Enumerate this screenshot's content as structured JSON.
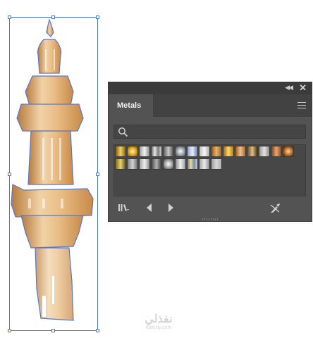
{
  "panel": {
    "tab_label": "Metals",
    "search": {
      "value": "",
      "placeholder": ""
    },
    "swatches": [
      {
        "name": "gold-1",
        "fill": "linear-gradient(90deg,#7a5a10,#f3d36a,#8a6410)"
      },
      {
        "name": "gold-radial",
        "fill": "radial-gradient(circle,#fff2a0,#d9a21a 55%,#6e4a05)"
      },
      {
        "name": "silver-1",
        "fill": "linear-gradient(90deg,#9a9a9a,#f4f4f4,#8a8a8a)"
      },
      {
        "name": "silver-2",
        "fill": "linear-gradient(90deg,#6c6c6c,#e6e6e6,#7a7a7a,#d8d8d8)"
      },
      {
        "name": "steel-1",
        "fill": "linear-gradient(90deg,#5e5e5e,#c9c9c9,#4e4e4e)"
      },
      {
        "name": "chrome-radial",
        "fill": "radial-gradient(circle,#ffffff,#a8b0b8 45%,#3e4348)"
      },
      {
        "name": "blue-steel",
        "fill": "linear-gradient(90deg,#8fa4c8,#e8eef8,#6f86b0)"
      },
      {
        "name": "platinum",
        "fill": "linear-gradient(90deg,#bdbdbd,#f8f8f8,#a9a9a9)"
      },
      {
        "name": "bronze-1",
        "fill": "linear-gradient(90deg,#8a5a1e,#e9b66a,#9a6424)"
      },
      {
        "name": "gold-2",
        "fill": "linear-gradient(90deg,#9a6c12,#ffd86e,#b17e1a)"
      },
      {
        "name": "copper-1",
        "fill": "linear-gradient(90deg,#8e5a26,#f0c38c,#a7692e)"
      },
      {
        "name": "brass",
        "fill": "linear-gradient(90deg,#6a4c1e,#e0c08a,#4c3614)"
      },
      {
        "name": "pewter",
        "fill": "linear-gradient(90deg,#9c9c9c,#e2e2e2,#8c8c8c)"
      },
      {
        "name": "copper-2",
        "fill": "linear-gradient(90deg,#7a3e14,#e6a87a,#8a4a1c)"
      },
      {
        "name": "copper-radial",
        "fill": "radial-gradient(circle,#ffd7a8,#b86a2a 55%,#3a1c06)"
      },
      {
        "name": "gold-3",
        "fill": "linear-gradient(90deg,#7c6616,#e7d47a,#6a5410)"
      },
      {
        "name": "steel-2",
        "fill": "linear-gradient(90deg,#7c7c7c,#d4d4d4,#6c6c6c)"
      },
      {
        "name": "steel-3",
        "fill": "linear-gradient(90deg,#a0a0a0,#efefef,#909090)"
      },
      {
        "name": "gunmetal",
        "fill": "linear-gradient(90deg,#4c4c4c,#b4b4b4,#3c3c3c)"
      },
      {
        "name": "silver-radial",
        "fill": "radial-gradient(circle,#ffffff,#a0a0a0 55%,#3c3c3c)"
      },
      {
        "name": "silver-3",
        "fill": "linear-gradient(90deg,#8a8a8a,#f0f0f0,#9a9a9a)"
      },
      {
        "name": "iridescent",
        "fill": "linear-gradient(90deg,#6a7aa0,#f2e07a,#7a8ab0,#c8d0e0)"
      },
      {
        "name": "silver-4",
        "fill": "linear-gradient(90deg,#a4a4a4,#ececec,#8e8e8e)"
      },
      {
        "name": "silver-5",
        "fill": "linear-gradient(90deg,#9e9e9e,#d8d8d8,#b0b0b0)"
      }
    ],
    "footer_icons": [
      "swatch-libraries-menu-icon",
      "previous-swatch-library-icon",
      "next-swatch-library-icon",
      "swatch-eyedropper-icon"
    ]
  },
  "watermark": {
    "arabic": "نفذلي",
    "latin": "nafezly.com"
  }
}
